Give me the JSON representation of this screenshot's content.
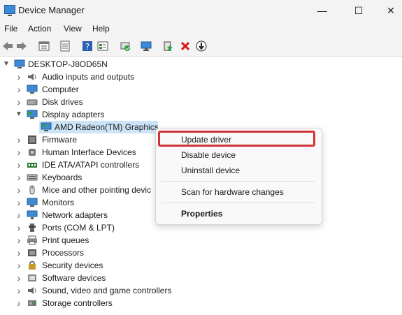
{
  "window": {
    "title": "Device Manager",
    "minimize": "—",
    "maximize": "☐",
    "close": "✕"
  },
  "menu": [
    "File",
    "Action",
    "View",
    "Help"
  ],
  "toolbar": [
    "back-icon",
    "forward-icon",
    "properties-sheet-icon",
    "show-hidden-icon",
    "help-icon",
    "resource-view-icon",
    "scan-hardware-icon",
    "monitor-icon",
    "update-driver-icon",
    "uninstall-icon",
    "disable-icon"
  ],
  "tree": {
    "root": "DESKTOP-J8OD65N",
    "categories": [
      {
        "label": "Audio inputs and outputs",
        "icon": "speaker-icon",
        "expanded": false
      },
      {
        "label": "Computer",
        "icon": "computer-icon",
        "expanded": false
      },
      {
        "label": "Disk drives",
        "icon": "disk-icon",
        "expanded": false
      },
      {
        "label": "Display adapters",
        "icon": "display-adapter-icon",
        "expanded": true
      },
      {
        "label": "Firmware",
        "icon": "firmware-icon",
        "expanded": false
      },
      {
        "label": "Human Interface Devices",
        "icon": "hid-icon",
        "expanded": false
      },
      {
        "label": "IDE ATA/ATAPI controllers",
        "icon": "ide-icon",
        "expanded": false
      },
      {
        "label": "Keyboards",
        "icon": "keyboard-icon",
        "expanded": false
      },
      {
        "label": "Mice and other pointing devic",
        "icon": "mouse-icon",
        "expanded": false
      },
      {
        "label": "Monitors",
        "icon": "monitor-icon",
        "expanded": false
      },
      {
        "label": "Network adapters",
        "icon": "network-icon",
        "expanded": false
      },
      {
        "label": "Ports (COM & LPT)",
        "icon": "port-icon",
        "expanded": false
      },
      {
        "label": "Print queues",
        "icon": "printer-icon",
        "expanded": false
      },
      {
        "label": "Processors",
        "icon": "processor-icon",
        "expanded": false
      },
      {
        "label": "Security devices",
        "icon": "security-icon",
        "expanded": false
      },
      {
        "label": "Software devices",
        "icon": "software-icon",
        "expanded": false
      },
      {
        "label": "Sound, video and game controllers",
        "icon": "sound-icon",
        "expanded": false
      },
      {
        "label": "Storage controllers",
        "icon": "storage-icon",
        "expanded": false
      }
    ],
    "selected_child": "AMD Radeon(TM) Graphics"
  },
  "context_menu": {
    "items": [
      "Update driver",
      "Disable device",
      "Uninstall device",
      "Scan for hardware changes",
      "Properties"
    ],
    "highlighted": "Update driver",
    "highlight_color": "#d13438"
  },
  "colors": {
    "chrome": "#f3f3f3",
    "selection": "#cce4f7",
    "accent": "#0067c0"
  }
}
